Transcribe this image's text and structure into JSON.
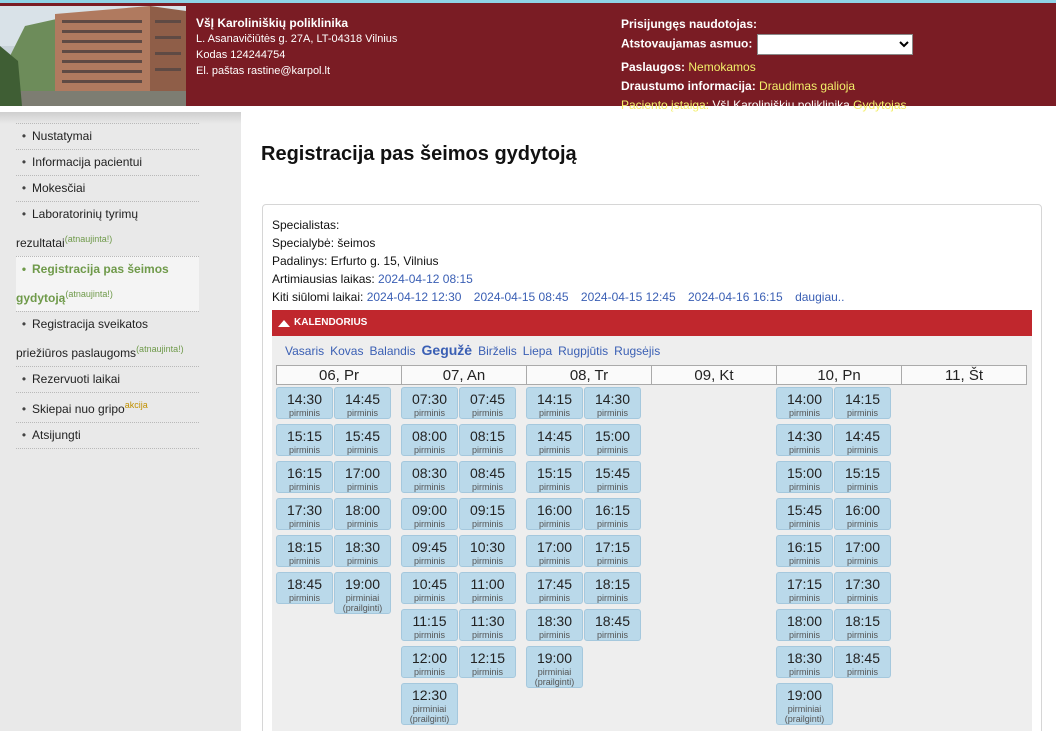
{
  "header": {
    "org_name": "VšĮ Karoliniškių poliklinika",
    "address": "L. Asanavičiūtės g. 27A, LT-04318 Vilnius",
    "code": "Kodas 124244754",
    "email": "El. paštas rastine@karpol.lt",
    "logged_user_label": "Prisijungęs naudotojas:",
    "represented_label": "Atstovaujamas asmuo:",
    "represented_value": "",
    "services_label": "Paslaugos:",
    "services_value": "Nemokamos",
    "insurance_label": "Draustumo informacija:",
    "insurance_value": "Draudimas galioja",
    "institution_label": "Paciento įstaiga:",
    "institution_value": "VšĮ Karoliniškių poliklinika",
    "institution_role": "Gydytojas"
  },
  "sidebar": {
    "items": [
      {
        "label": "Nustatymai",
        "label2": "",
        "badge": ""
      },
      {
        "label": "Informacija pacientui",
        "label2": "",
        "badge": ""
      },
      {
        "label": "Mokesčiai",
        "label2": "",
        "badge": ""
      },
      {
        "label": "Laboratorinių tyrimų",
        "label2": "rezultatai",
        "badge": "(atnaujinta!)"
      },
      {
        "label": "Registracija pas šeimos",
        "label2": "gydytoją",
        "badge": "(atnaujinta!)"
      },
      {
        "label": "Registracija sveikatos",
        "label2": "priežiūros paslaugoms",
        "badge": "(atnaujinta!)"
      },
      {
        "label": "Rezervuoti laikai",
        "label2": "",
        "badge": ""
      },
      {
        "label": "Skiepai nuo gripo",
        "label2": "",
        "badge": "akcija"
      },
      {
        "label": "Atsijungti",
        "label2": "",
        "badge": ""
      }
    ]
  },
  "main": {
    "title": "Registracija pas šeimos gydytoją",
    "specialist_label": "Specialistas:",
    "specialty_label": "Specialybė:",
    "specialty_value": "šeimos",
    "unit_label": "Padalinys:",
    "unit_value": "Erfurto g. 15, Vilnius",
    "nearest_label": "Artimiausias laikas:",
    "nearest_value": "2024-04-12 08:15",
    "other_label": "Kiti siūlomi laikai:",
    "other_times": [
      "2024-04-12 12:30",
      "2024-04-15 08:45",
      "2024-04-15 12:45",
      "2024-04-16 16:15"
    ],
    "more_link": "daugiau.."
  },
  "calendar": {
    "header": "KALENDORIUS",
    "months": [
      "Vasaris",
      "Kovas",
      "Balandis",
      "Gegužė",
      "Birželis",
      "Liepa",
      "Rugpjūtis",
      "Rugsėjis"
    ],
    "current_month_index": 3,
    "colors": {
      "slot_bg": "#bad9ea",
      "bar": "#c0272d",
      "accent": "#3a5fb4"
    },
    "days": [
      {
        "label": "06, Pr",
        "slots": [
          {
            "time": "14:30",
            "note": "pirminis"
          },
          {
            "time": "14:45",
            "note": "pirminis"
          },
          {
            "time": "15:15",
            "note": "pirminis"
          },
          {
            "time": "15:45",
            "note": "pirminis"
          },
          {
            "time": "16:15",
            "note": "pirminis"
          },
          {
            "time": "17:00",
            "note": "pirminis"
          },
          {
            "time": "17:30",
            "note": "pirminis"
          },
          {
            "time": "18:00",
            "note": "pirminis"
          },
          {
            "time": "18:15",
            "note": "pirminis"
          },
          {
            "time": "18:30",
            "note": "pirminis"
          },
          {
            "time": "18:45",
            "note": "pirminis"
          },
          {
            "time": "19:00",
            "note": "pirminiai (prailginti)"
          }
        ]
      },
      {
        "label": "07, An",
        "slots": [
          {
            "time": "07:30",
            "note": "pirminis"
          },
          {
            "time": "07:45",
            "note": "pirminis"
          },
          {
            "time": "08:00",
            "note": "pirminis"
          },
          {
            "time": "08:15",
            "note": "pirminis"
          },
          {
            "time": "08:30",
            "note": "pirminis"
          },
          {
            "time": "08:45",
            "note": "pirminis"
          },
          {
            "time": "09:00",
            "note": "pirminis"
          },
          {
            "time": "09:15",
            "note": "pirminis"
          },
          {
            "time": "09:45",
            "note": "pirminis"
          },
          {
            "time": "10:30",
            "note": "pirminis"
          },
          {
            "time": "10:45",
            "note": "pirminis"
          },
          {
            "time": "11:00",
            "note": "pirminis"
          },
          {
            "time": "11:15",
            "note": "pirminis"
          },
          {
            "time": "11:30",
            "note": "pirminis"
          },
          {
            "time": "12:00",
            "note": "pirminis"
          },
          {
            "time": "12:15",
            "note": "pirminis"
          },
          {
            "time": "12:30",
            "note": "pirminiai (prailginti)"
          }
        ]
      },
      {
        "label": "08, Tr",
        "slots": [
          {
            "time": "14:15",
            "note": "pirminis"
          },
          {
            "time": "14:30",
            "note": "pirminis"
          },
          {
            "time": "14:45",
            "note": "pirminis"
          },
          {
            "time": "15:00",
            "note": "pirminis"
          },
          {
            "time": "15:15",
            "note": "pirminis"
          },
          {
            "time": "15:45",
            "note": "pirminis"
          },
          {
            "time": "16:00",
            "note": "pirminis"
          },
          {
            "time": "16:15",
            "note": "pirminis"
          },
          {
            "time": "17:00",
            "note": "pirminis"
          },
          {
            "time": "17:15",
            "note": "pirminis"
          },
          {
            "time": "17:45",
            "note": "pirminis"
          },
          {
            "time": "18:15",
            "note": "pirminis"
          },
          {
            "time": "18:30",
            "note": "pirminis"
          },
          {
            "time": "18:45",
            "note": "pirminis"
          },
          {
            "time": "19:00",
            "note": "pirminiai (prailginti)"
          }
        ]
      },
      {
        "label": "09, Kt",
        "slots": []
      },
      {
        "label": "10, Pn",
        "slots": [
          {
            "time": "14:00",
            "note": "pirminis"
          },
          {
            "time": "14:15",
            "note": "pirminis"
          },
          {
            "time": "14:30",
            "note": "pirminis"
          },
          {
            "time": "14:45",
            "note": "pirminis"
          },
          {
            "time": "15:00",
            "note": "pirminis"
          },
          {
            "time": "15:15",
            "note": "pirminis"
          },
          {
            "time": "15:45",
            "note": "pirminis"
          },
          {
            "time": "16:00",
            "note": "pirminis"
          },
          {
            "time": "16:15",
            "note": "pirminis"
          },
          {
            "time": "17:00",
            "note": "pirminis"
          },
          {
            "time": "17:15",
            "note": "pirminis"
          },
          {
            "time": "17:30",
            "note": "pirminis"
          },
          {
            "time": "18:00",
            "note": "pirminis"
          },
          {
            "time": "18:15",
            "note": "pirminis"
          },
          {
            "time": "18:30",
            "note": "pirminis"
          },
          {
            "time": "18:45",
            "note": "pirminis"
          },
          {
            "time": "19:00",
            "note": "pirminiai (prailginti)"
          }
        ]
      },
      {
        "label": "11, Št",
        "slots": []
      }
    ]
  }
}
